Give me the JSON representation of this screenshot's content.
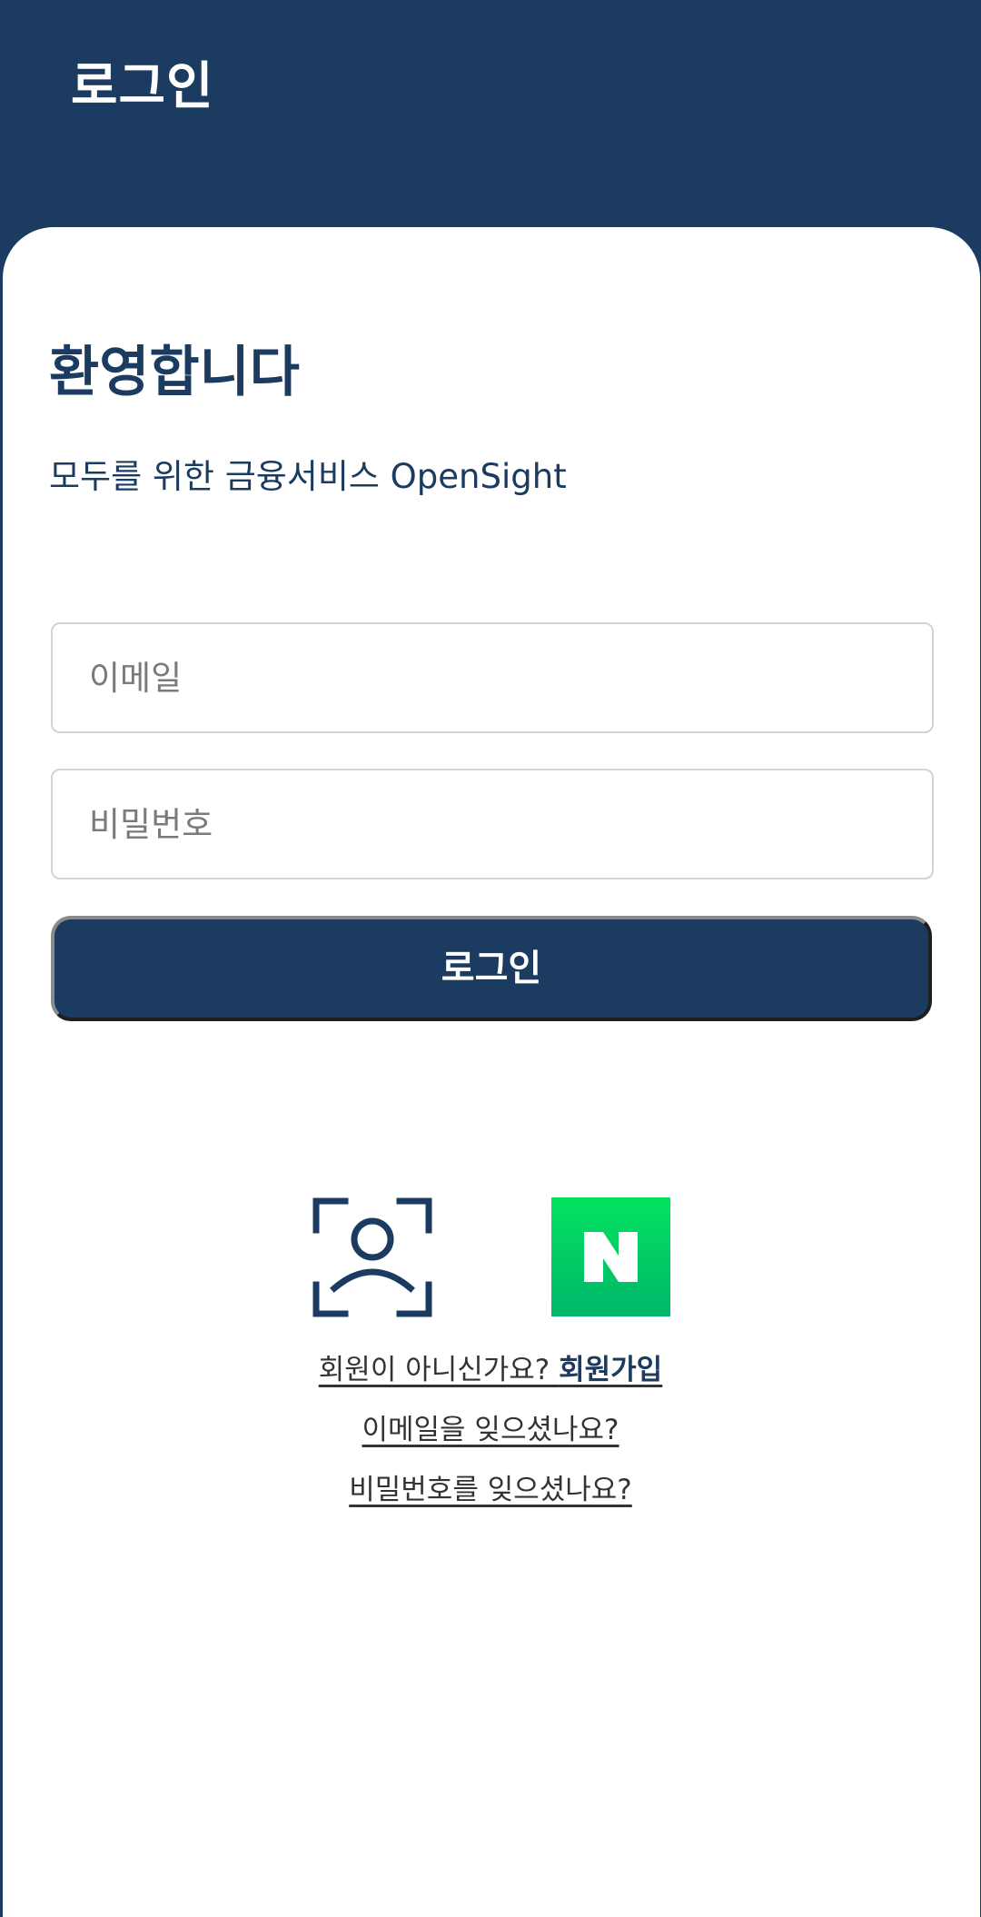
{
  "header": {
    "title": "로그인"
  },
  "welcome": {
    "heading": "환영합니다",
    "subtitle": "모두를 위한 금융서비스 OpenSight"
  },
  "form": {
    "email_placeholder": "이메일",
    "password_placeholder": "비밀번호",
    "login_button": "로그인"
  },
  "social": {
    "icons": [
      "face-recognition-icon",
      "naver-icon"
    ],
    "naver_color": "#03c75a"
  },
  "links": {
    "not_member": "회원이 아니신가요? ",
    "signup": "회원가입",
    "forgot_email": "이메일을 잊으셨나요?",
    "forgot_password": "비밀번호를 잊으셨나요?"
  },
  "colors": {
    "primary": "#1c3b61",
    "background": "#ffffff",
    "field_border": "#d3d3d3"
  }
}
